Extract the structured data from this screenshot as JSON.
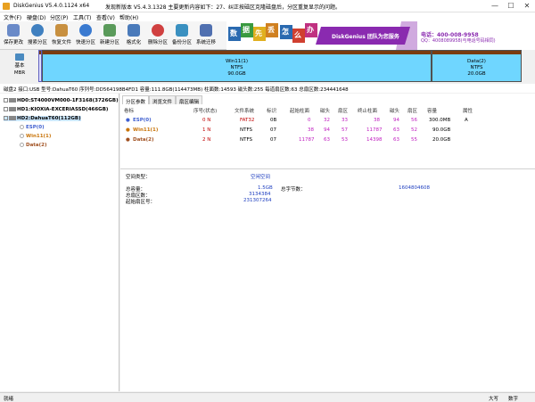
{
  "title_bar": {
    "app_title": "DiskGenius V5.4.0.1124 x64",
    "notice": "发现新版本 V5.4.3.1328 主要更新内容如下：27、纠正按磁区克隆磁盘后，分区重复显示的问题。",
    "minimize": "—",
    "maximize": "☐",
    "close": "✕"
  },
  "menu": [
    "文件(F)",
    "硬盘(D)",
    "分区(P)",
    "工具(T)",
    "查看(V)",
    "帮助(H)"
  ],
  "toolbar": [
    {
      "label": "保存更改",
      "icon": "save-icon",
      "color": "#6a8ac8"
    },
    {
      "label": "搜索分区",
      "icon": "search-partition-icon",
      "color": "#4080c0"
    },
    {
      "label": "恢复文件",
      "icon": "recover-file-icon",
      "color": "#c89040"
    },
    {
      "label": "快速分区",
      "icon": "quick-partition-icon",
      "color": "#3a7ad0"
    },
    {
      "label": "新建分区",
      "icon": "new-partition-icon",
      "color": "#5a9a5a"
    },
    {
      "label": "格式化",
      "icon": "format-icon",
      "color": "#4a7aba"
    },
    {
      "label": "删除分区",
      "icon": "delete-partition-icon",
      "color": "#d04040"
    },
    {
      "label": "备份分区",
      "icon": "backup-partition-icon",
      "color": "#3a90c0"
    },
    {
      "label": "系统迁移",
      "icon": "system-migrate-icon",
      "color": "#5070b0"
    }
  ],
  "banner": {
    "chars": [
      "数",
      "据",
      "先",
      "丢",
      "怎",
      "么",
      "办"
    ],
    "slogan": "DiskGenius 团队为您服务",
    "phone": "电话：400-008-9958",
    "qq": "QQ：4008089958(与电话号码相同)"
  },
  "disk_map": {
    "label_lines": [
      "基本",
      "MBR"
    ],
    "partitions": [
      {
        "name": "ESP(0)"
      },
      {
        "name": "Win11(1)",
        "fs": "NTFS",
        "size": "90.0GB"
      },
      {
        "name": "Data(2)",
        "fs": "NTFS",
        "size": "20.0GB"
      }
    ]
  },
  "disk_info": "磁盘2 接口:USB  型号:DahuaT60  序列号:DD564198B4FD1  容量:111.8GB(114473MB)  柱面数:14593  磁头数:255  每道扇区数:63  总扇区数:234441648",
  "tree": [
    {
      "label": "HD0:ST4000VM000-1F3168(3726GB)",
      "level": 0
    },
    {
      "label": "HD1:KIOXIA-EXCERIASSD(466GB)",
      "level": 0
    },
    {
      "label": "HD2:DahuaT60(112GB)",
      "level": 0
    },
    {
      "label": "ESP(0)",
      "level": 1,
      "kind": "esp"
    },
    {
      "label": "Win11(1)",
      "level": 1,
      "kind": "win"
    },
    {
      "label": "Data(2)",
      "level": 1,
      "kind": "data"
    }
  ],
  "tabs": [
    "分区参数",
    "浏览文件",
    "扇区编辑"
  ],
  "table": {
    "headers": [
      "卷标",
      "序号(状态)",
      "文件系统",
      "标识",
      "起始柱面",
      "磁头",
      "扇区",
      "终止柱面",
      "磁头",
      "扇区",
      "容量",
      "属性"
    ],
    "rows": [
      {
        "kind": "esp",
        "cells": [
          "ESP(0)",
          "0 N",
          "FAT32",
          "0B",
          "0",
          "32",
          "33",
          "38",
          "94",
          "56",
          "300.0MB",
          "A"
        ]
      },
      {
        "kind": "win",
        "cells": [
          "Win11(1)",
          "1 N",
          "NTFS",
          "07",
          "38",
          "94",
          "57",
          "11787",
          "63",
          "52",
          "90.0GB",
          ""
        ]
      },
      {
        "kind": "data",
        "cells": [
          "Data(2)",
          "2 N",
          "NTFS",
          "07",
          "11787",
          "63",
          "53",
          "14398",
          "63",
          "55",
          "20.0GB",
          ""
        ]
      }
    ]
  },
  "details": {
    "type_label": "空间类型：",
    "type_value": "空闲空间",
    "total_cap_label": "总容量：",
    "total_cap_value": "1.5GB",
    "total_bytes_label": "总字节数：",
    "total_bytes_value": "1604804608",
    "total_sectors_label": "总扇区数：",
    "total_sectors_value": "3134384",
    "start_sector_label": "起始扇区号：",
    "start_sector_value": "231307264"
  },
  "status": {
    "left": "就绪",
    "caps": "大写",
    "num": "数字"
  },
  "colors": {
    "accent_bar": "#7a3b10",
    "partition_fill": "#6fd6ff",
    "esp": "#4060d0",
    "win": "#c8740a",
    "data": "#a05020"
  }
}
